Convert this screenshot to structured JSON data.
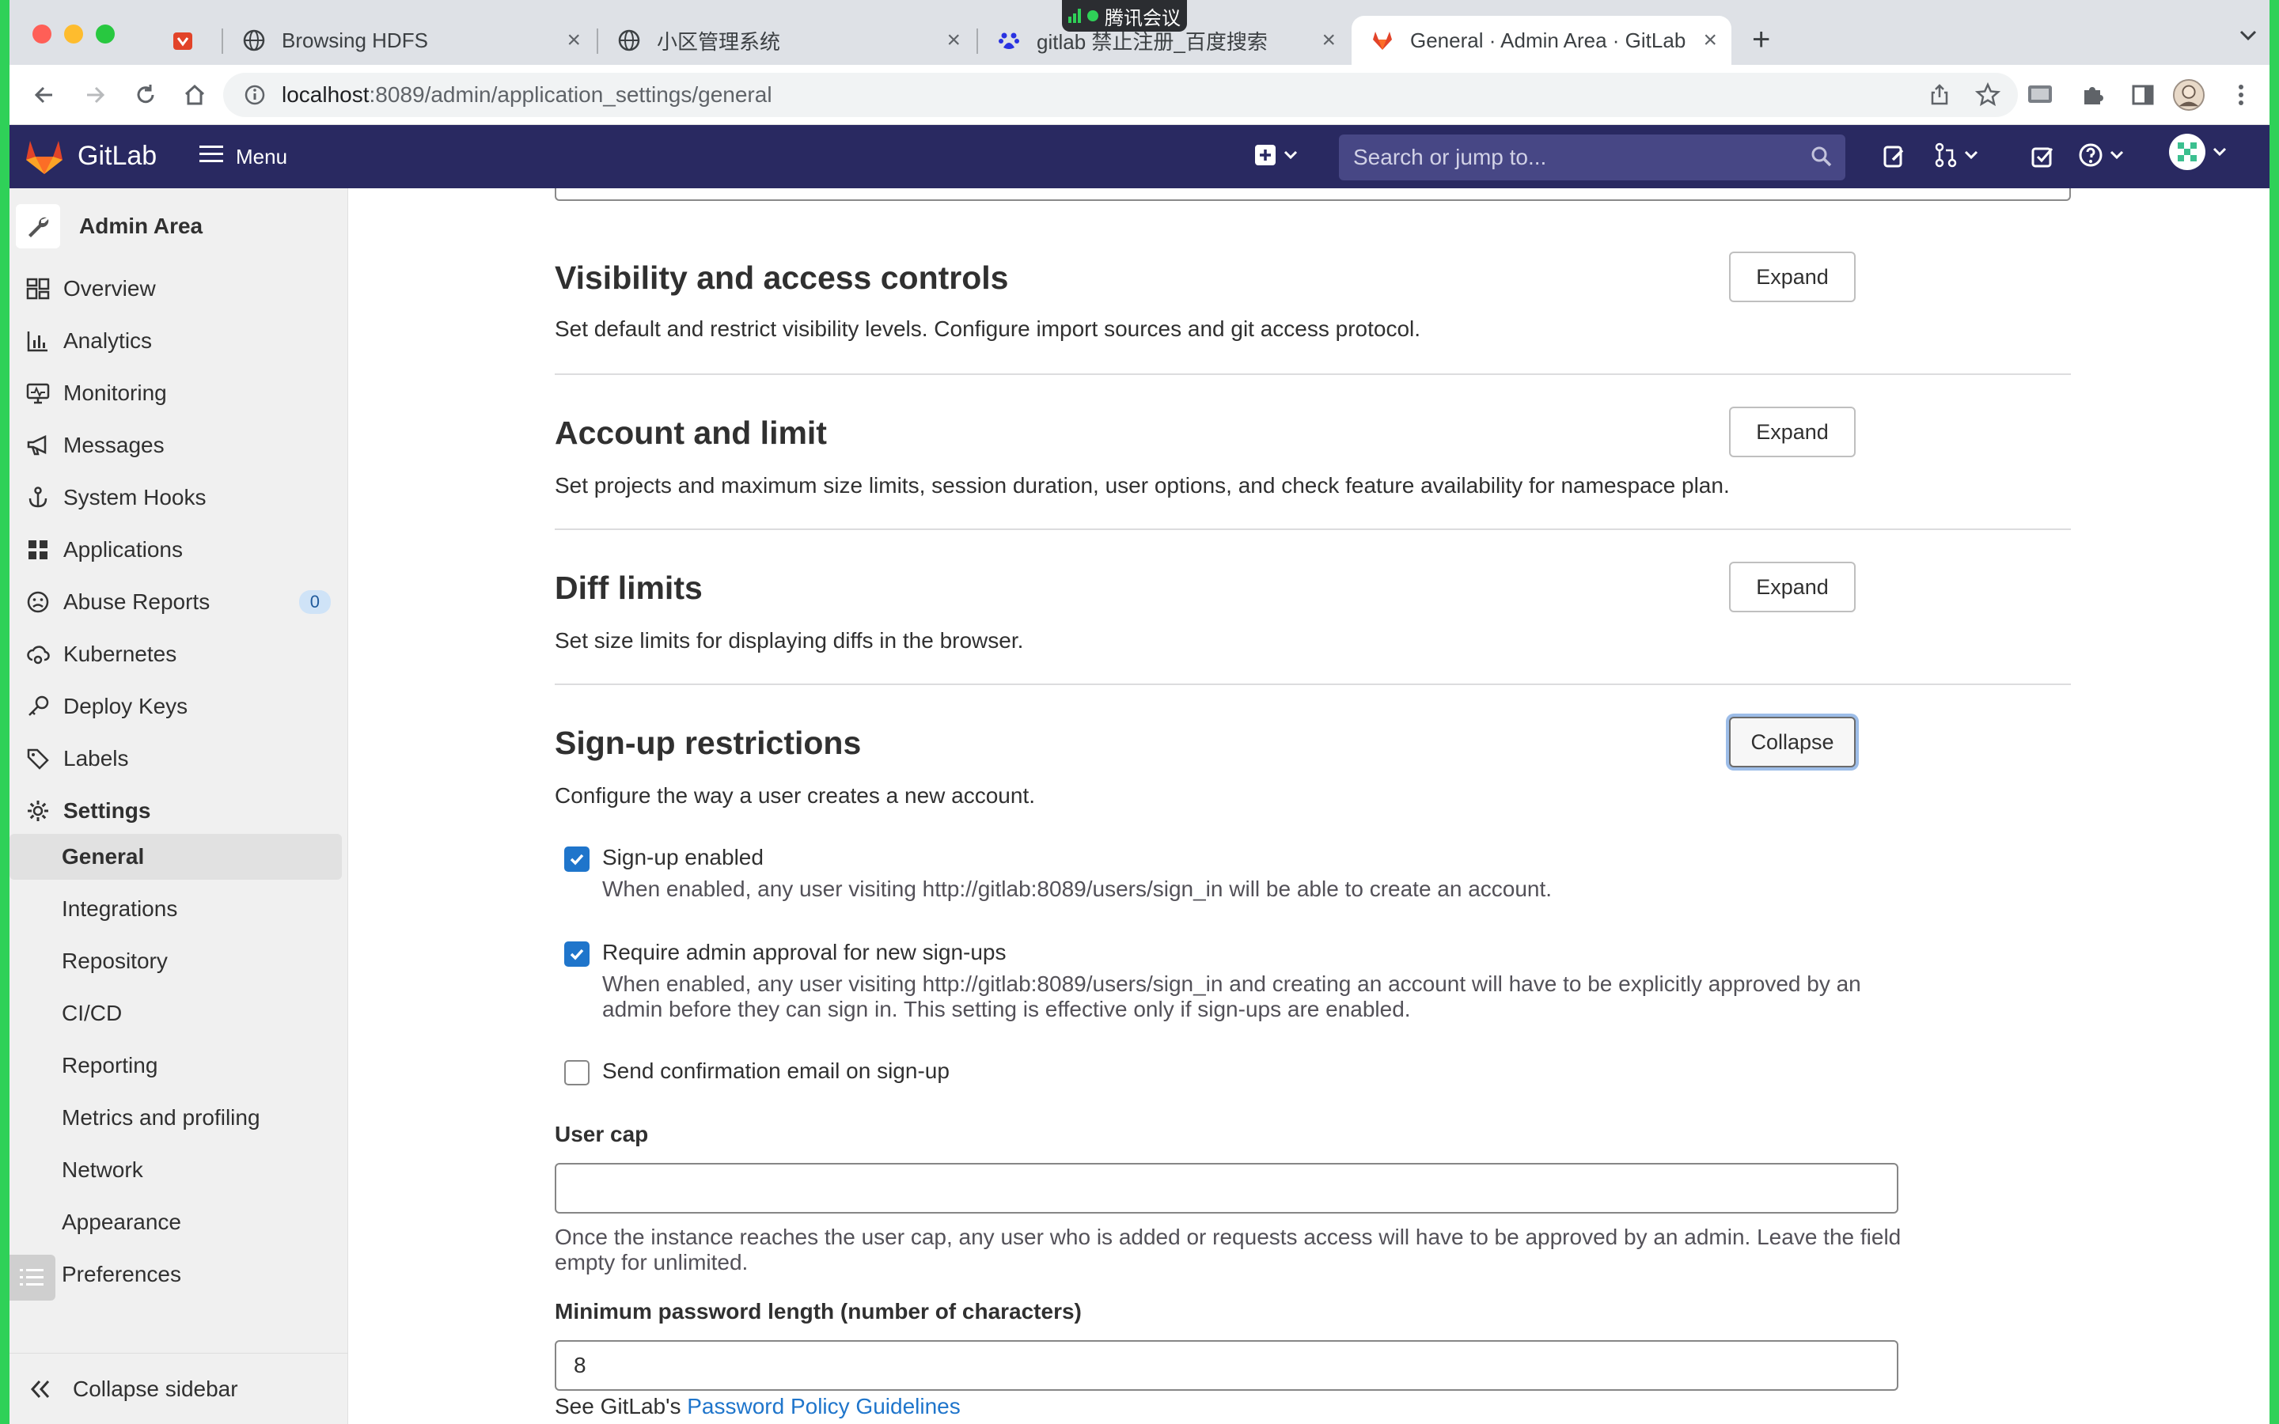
{
  "browser": {
    "tabs": [
      {
        "title": ""
      },
      {
        "title": "Browsing HDFS"
      },
      {
        "title": "小区管理系统"
      },
      {
        "title": "gitlab 禁止注册_百度搜索"
      },
      {
        "title": "General · Admin Area · GitLab"
      }
    ],
    "meeting_badge": "腾讯会议",
    "url_host": "localhost",
    "url_path": ":8089/admin/application_settings/general"
  },
  "header": {
    "brand": "GitLab",
    "menu_label": "Menu",
    "search_placeholder": "Search or jump to..."
  },
  "sidebar": {
    "title": "Admin Area",
    "items": [
      {
        "label": "Overview",
        "icon": "overview-icon"
      },
      {
        "label": "Analytics",
        "icon": "chart-icon"
      },
      {
        "label": "Monitoring",
        "icon": "monitor-icon"
      },
      {
        "label": "Messages",
        "icon": "bullhorn-icon"
      },
      {
        "label": "System Hooks",
        "icon": "hook-icon"
      },
      {
        "label": "Applications",
        "icon": "applications-icon"
      },
      {
        "label": "Abuse Reports",
        "icon": "sad-face-icon",
        "badge": "0"
      },
      {
        "label": "Kubernetes",
        "icon": "cloud-gear-icon"
      },
      {
        "label": "Deploy Keys",
        "icon": "key-icon"
      },
      {
        "label": "Labels",
        "icon": "label-icon"
      },
      {
        "label": "Settings",
        "icon": "gear-icon"
      }
    ],
    "settings_sub": [
      {
        "label": "General",
        "active": true
      },
      {
        "label": "Integrations"
      },
      {
        "label": "Repository"
      },
      {
        "label": "CI/CD"
      },
      {
        "label": "Reporting"
      },
      {
        "label": "Metrics and profiling"
      },
      {
        "label": "Network"
      },
      {
        "label": "Appearance"
      },
      {
        "label": "Preferences"
      }
    ],
    "collapse_label": "Collapse sidebar"
  },
  "main": {
    "sections": [
      {
        "title": "Visibility and access controls",
        "desc": "Set default and restrict visibility levels. Configure import sources and git access protocol.",
        "button": "Expand"
      },
      {
        "title": "Account and limit",
        "desc": "Set projects and maximum size limits, session duration, user options, and check feature availability for namespace plan.",
        "button": "Expand"
      },
      {
        "title": "Diff limits",
        "desc": "Set size limits for displaying diffs in the browser.",
        "button": "Expand"
      },
      {
        "title": "Sign-up restrictions",
        "desc": "Configure the way a user creates a new account.",
        "button": "Collapse"
      }
    ],
    "signup": {
      "signup_enabled": {
        "label": "Sign-up enabled",
        "checked": true,
        "help": "When enabled, any user visiting http://gitlab:8089/users/sign_in will be able to create an account."
      },
      "admin_approval": {
        "label": "Require admin approval for new sign-ups",
        "checked": true,
        "help": "When enabled, any user visiting http://gitlab:8089/users/sign_in and creating an account will have to be explicitly approved by an admin before they can sign in. This setting is effective only if sign-ups are enabled."
      },
      "confirm_email": {
        "label": "Send confirmation email on sign-up",
        "checked": false
      },
      "user_cap": {
        "label": "User cap",
        "value": "",
        "help": "Once the instance reaches the user cap, any user who is added or requests access will have to be approved by an admin. Leave the field empty for unlimited."
      },
      "min_password": {
        "label": "Minimum password length (number of characters)",
        "value": "8",
        "help_prefix": "See GitLab's ",
        "help_link": "Password Policy Guidelines"
      }
    }
  }
}
